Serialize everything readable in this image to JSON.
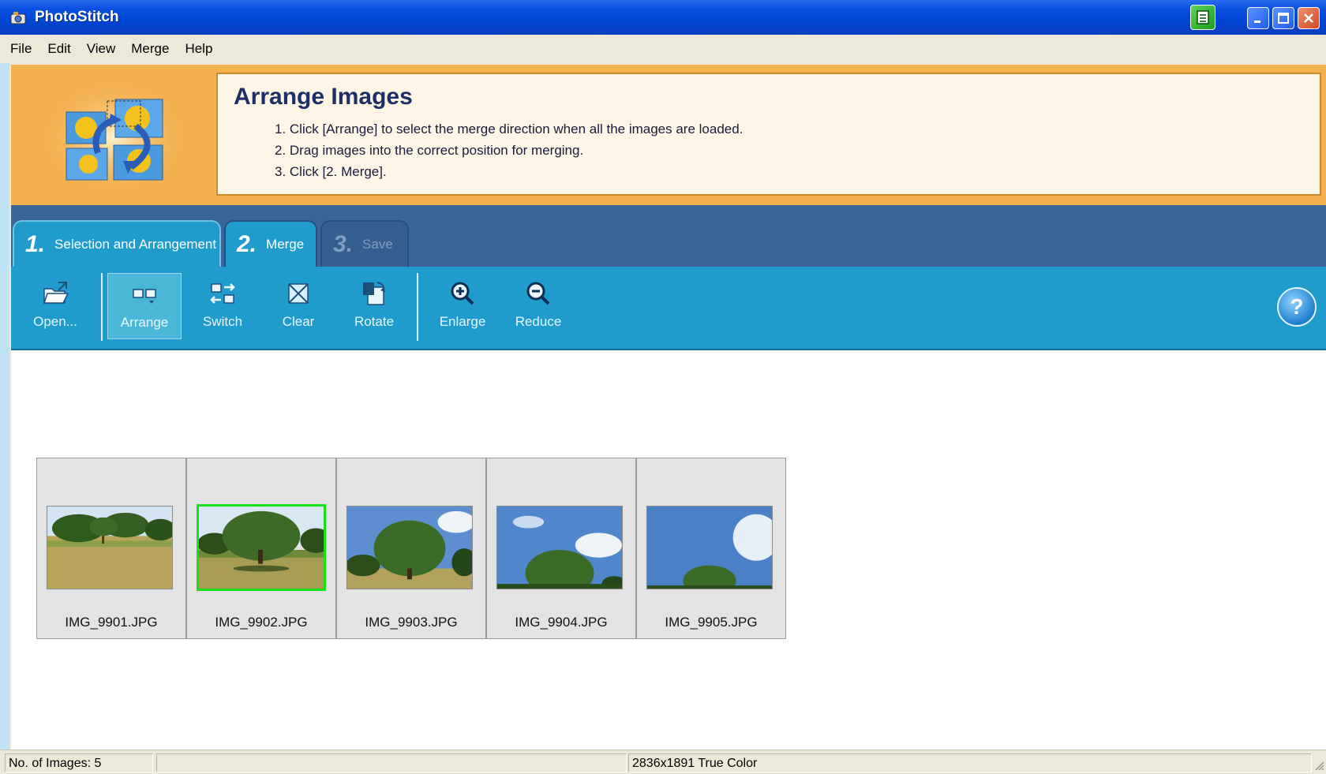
{
  "window": {
    "title": "PhotoStitch",
    "icon": "photostitch-app-icon"
  },
  "menubar": {
    "items": [
      {
        "label": "File"
      },
      {
        "label": "Edit"
      },
      {
        "label": "View"
      },
      {
        "label": "Merge"
      },
      {
        "label": "Help"
      }
    ]
  },
  "header": {
    "title": "Arrange Images",
    "steps": [
      "1. Click [Arrange] to select the merge direction when all the images are loaded.",
      "2. Drag images into the correct position for merging.",
      "3. Click [2. Merge]."
    ]
  },
  "tabs": [
    {
      "number": "1.",
      "label": "Selection and Arrangement",
      "state": "active"
    },
    {
      "number": "2.",
      "label": "Merge",
      "state": "normal"
    },
    {
      "number": "3.",
      "label": "Save",
      "state": "disabled"
    }
  ],
  "toolbar": {
    "tools": [
      {
        "label": "Open...",
        "icon": "open-folder-icon"
      },
      {
        "label": "Arrange",
        "icon": "arrange-icon",
        "selected": true
      },
      {
        "label": "Switch",
        "icon": "switch-arrows-icon"
      },
      {
        "label": "Clear",
        "icon": "clear-icon"
      },
      {
        "label": "Rotate",
        "icon": "rotate-icon"
      },
      {
        "label": "Enlarge",
        "icon": "zoom-in-icon"
      },
      {
        "label": "Reduce",
        "icon": "zoom-out-icon"
      }
    ],
    "help": "?"
  },
  "images": [
    {
      "name": "IMG_9901.JPG",
      "selected": false
    },
    {
      "name": "IMG_9902.JPG",
      "selected": true
    },
    {
      "name": "IMG_9903.JPG",
      "selected": false
    },
    {
      "name": "IMG_9904.JPG",
      "selected": false
    },
    {
      "name": "IMG_9905.JPG",
      "selected": false
    }
  ],
  "status": {
    "count": "No. of Images: 5",
    "middle": "",
    "resolution": "2836x1891 True Color"
  },
  "colors": {
    "titlebar": "#0046d5",
    "header_bg": "#f4b150",
    "tabs_bg": "#3a6599",
    "toolbar_bg": "#1f9ccc",
    "selection_border": "#18e018"
  }
}
